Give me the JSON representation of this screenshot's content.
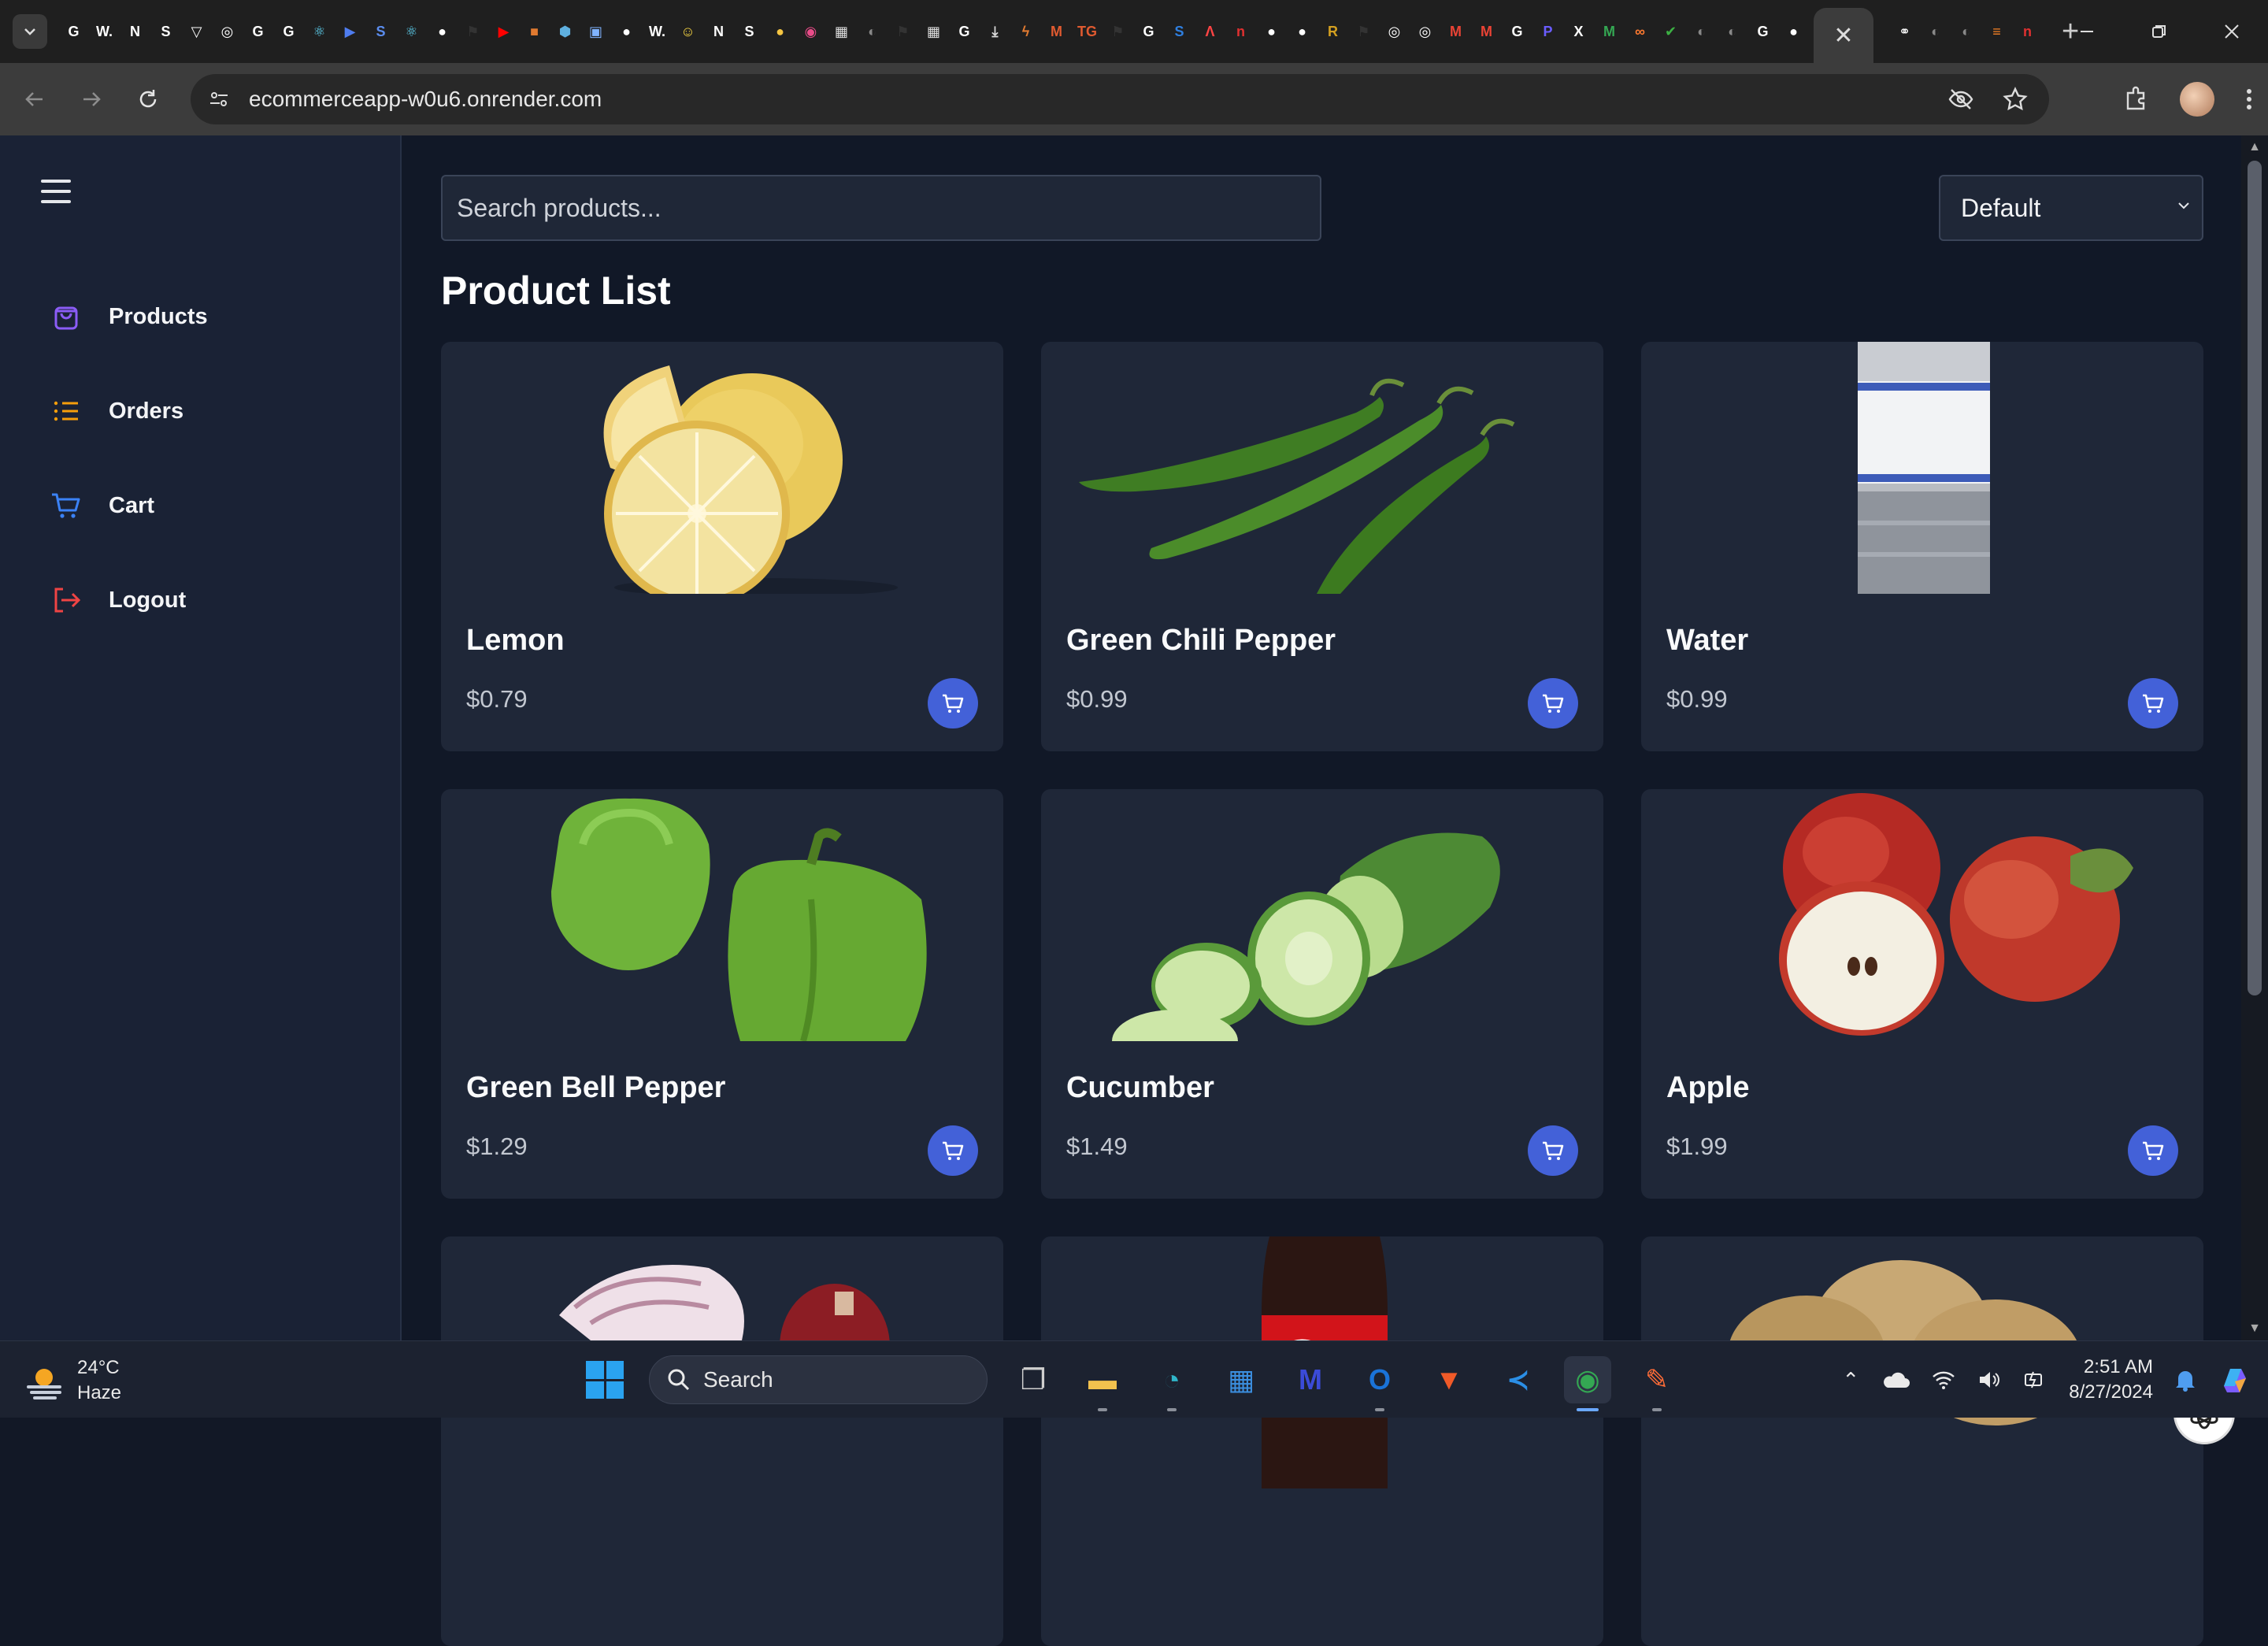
{
  "browser": {
    "url": "ecommerceapp-w0u6.onrender.com",
    "tab_close": "✕",
    "new_tab": "+",
    "tab_icons": [
      {
        "icon": "google-icon",
        "glyph": "G",
        "color": "#ffffff"
      },
      {
        "icon": "w-icon",
        "glyph": "W.",
        "color": "#ffffff"
      },
      {
        "icon": "notion-icon",
        "glyph": "N",
        "color": "#ffffff"
      },
      {
        "icon": "s-icon",
        "glyph": "S",
        "color": "#ffffff"
      },
      {
        "icon": "vercel-icon",
        "glyph": "▽",
        "color": "#ffffff"
      },
      {
        "icon": "openai-icon",
        "glyph": "◎",
        "color": "#ffffff"
      },
      {
        "icon": "google-icon",
        "glyph": "G",
        "color": "#ffffff"
      },
      {
        "icon": "google-icon",
        "glyph": "G",
        "color": "#ffffff"
      },
      {
        "icon": "react-icon",
        "glyph": "⚛",
        "color": "#61dafb"
      },
      {
        "icon": "play-icon",
        "glyph": "▶",
        "color": "#4f7df0"
      },
      {
        "icon": "s-icon",
        "glyph": "S",
        "color": "#5b8def"
      },
      {
        "icon": "react-icon",
        "glyph": "⚛",
        "color": "#61dafb"
      },
      {
        "icon": "github-icon",
        "glyph": "●",
        "color": "#ffffff"
      },
      {
        "icon": "flag-icon",
        "glyph": "⚑",
        "color": "#333333"
      },
      {
        "icon": "youtube-icon",
        "glyph": "▶",
        "color": "#ff0000"
      },
      {
        "icon": "box-icon",
        "glyph": "■",
        "color": "#e07a30"
      },
      {
        "icon": "cube-icon",
        "glyph": "⬢",
        "color": "#5fb0e0"
      },
      {
        "icon": "image-icon",
        "glyph": "▣",
        "color": "#7fb3ff"
      },
      {
        "icon": "github-icon",
        "glyph": "●",
        "color": "#ffffff"
      },
      {
        "icon": "w-icon",
        "glyph": "W.",
        "color": "#ffffff"
      },
      {
        "icon": "smiley-icon",
        "glyph": "☺",
        "color": "#f5d442"
      },
      {
        "icon": "notion-icon",
        "glyph": "N",
        "color": "#ffffff"
      },
      {
        "icon": "s-icon",
        "glyph": "S",
        "color": "#ffffff"
      },
      {
        "icon": "circle-icon",
        "glyph": "●",
        "color": "#f5c542"
      },
      {
        "icon": "dribbble-icon",
        "glyph": "◉",
        "color": "#ea4c89"
      },
      {
        "icon": "qr-icon",
        "glyph": "▦",
        "color": "#dddddd"
      },
      {
        "icon": "globe-icon",
        "glyph": "◐",
        "color": "#888888"
      },
      {
        "icon": "flag-icon",
        "glyph": "⚑",
        "color": "#333333"
      },
      {
        "icon": "qr-icon",
        "glyph": "▦",
        "color": "#dddddd"
      },
      {
        "icon": "google-icon",
        "glyph": "G",
        "color": "#ffffff"
      },
      {
        "icon": "download-icon",
        "glyph": "⤓",
        "color": "#dddddd"
      },
      {
        "icon": "bolt-icon",
        "glyph": "ϟ",
        "color": "#e07a30"
      },
      {
        "icon": "m-icon",
        "glyph": "M",
        "color": "#e05a30"
      },
      {
        "icon": "tg-icon",
        "glyph": "TG",
        "color": "#e05a30"
      },
      {
        "icon": "flag-icon",
        "glyph": "⚑",
        "color": "#333333"
      },
      {
        "icon": "google-icon",
        "glyph": "G",
        "color": "#ffffff"
      },
      {
        "icon": "s-icon",
        "glyph": "S",
        "color": "#2f7fe0"
      },
      {
        "icon": "a-icon",
        "glyph": "Λ",
        "color": "#ff4444"
      },
      {
        "icon": "n-icon",
        "glyph": "n",
        "color": "#e03030"
      },
      {
        "icon": "github-icon",
        "glyph": "●",
        "color": "#ffffff"
      },
      {
        "icon": "github-icon",
        "glyph": "●",
        "color": "#ffffff"
      },
      {
        "icon": "r-icon",
        "glyph": "R",
        "color": "#d4a020"
      },
      {
        "icon": "flag-icon",
        "glyph": "⚑",
        "color": "#333333"
      },
      {
        "icon": "openai-icon",
        "glyph": "◎",
        "color": "#ffffff"
      },
      {
        "icon": "openai-icon",
        "glyph": "◎",
        "color": "#ffffff"
      },
      {
        "icon": "gmail-icon",
        "glyph": "M",
        "color": "#ea4335"
      },
      {
        "icon": "gmail-icon",
        "glyph": "M",
        "color": "#ea4335"
      },
      {
        "icon": "google-icon",
        "glyph": "G",
        "color": "#ffffff"
      },
      {
        "icon": "p-icon",
        "glyph": "P",
        "color": "#6a5cff"
      },
      {
        "icon": "x-icon",
        "glyph": "X",
        "color": "#ffffff"
      },
      {
        "icon": "mail-icon",
        "glyph": "M",
        "color": "#34a853"
      },
      {
        "icon": "infinity-icon",
        "glyph": "∞",
        "color": "#ff7a30"
      },
      {
        "icon": "shield-icon",
        "glyph": "✔",
        "color": "#3cb043"
      },
      {
        "icon": "globe-icon",
        "glyph": "◐",
        "color": "#888888"
      },
      {
        "icon": "globe-icon",
        "glyph": "◐",
        "color": "#888888"
      },
      {
        "icon": "google-icon",
        "glyph": "G",
        "color": "#ffffff"
      },
      {
        "icon": "github-icon",
        "glyph": "●",
        "color": "#ffffff"
      }
    ],
    "tab_icons_after": [
      {
        "icon": "link-icon",
        "glyph": "⚭",
        "color": "#ffffff"
      },
      {
        "icon": "globe-icon",
        "glyph": "◐",
        "color": "#888888"
      },
      {
        "icon": "globe-icon",
        "glyph": "◐",
        "color": "#888888"
      },
      {
        "icon": "stack-icon",
        "glyph": "≡",
        "color": "#f48024"
      },
      {
        "icon": "n-icon",
        "glyph": "n",
        "color": "#e03030"
      }
    ]
  },
  "sidebar": {
    "items": [
      {
        "label": "Products",
        "icon": "bag-icon",
        "color": "#8b5cf6"
      },
      {
        "label": "Orders",
        "icon": "list-icon",
        "color": "#f59e0b"
      },
      {
        "label": "Cart",
        "icon": "cart-icon",
        "color": "#3b82f6"
      },
      {
        "label": "Logout",
        "icon": "logout-icon",
        "color": "#ef4444"
      }
    ]
  },
  "main": {
    "search_placeholder": "Search products...",
    "sort_selected": "Default",
    "title": "Product List"
  },
  "products": [
    {
      "name": "Lemon",
      "price": "$0.79",
      "image": "lemon"
    },
    {
      "name": "Green Chili Pepper",
      "price": "$0.99",
      "image": "chili"
    },
    {
      "name": "Water",
      "price": "$0.99",
      "image": "water"
    },
    {
      "name": "Green Bell Pepper",
      "price": "$1.29",
      "image": "bell-pepper"
    },
    {
      "name": "Cucumber",
      "price": "$1.49",
      "image": "cucumber"
    },
    {
      "name": "Apple",
      "price": "$1.99",
      "image": "apple"
    },
    {
      "name": "",
      "price": "",
      "image": "onion"
    },
    {
      "name": "",
      "price": "",
      "image": "cola"
    },
    {
      "name": "",
      "price": "",
      "image": "potato"
    }
  ],
  "taskbar": {
    "temperature": "24°C",
    "weather": "Haze",
    "search_label": "Search",
    "time": "2:51 AM",
    "date": "8/27/2024",
    "apps": [
      {
        "icon": "task-view-icon",
        "glyph": "❐",
        "color": "#cfcfcf"
      },
      {
        "icon": "file-explorer-icon",
        "glyph": "▬",
        "color": "#f2c14e"
      },
      {
        "icon": "edge-icon",
        "glyph": "◔",
        "color": "#2fb5c9"
      },
      {
        "icon": "store-icon",
        "glyph": "▦",
        "color": "#3b8fe0"
      },
      {
        "icon": "mathpix-icon",
        "glyph": "M",
        "color": "#3b4bd8"
      },
      {
        "icon": "outlook-icon",
        "glyph": "O",
        "color": "#1a73d8"
      },
      {
        "icon": "brave-icon",
        "glyph": "▼",
        "color": "#f05a28"
      },
      {
        "icon": "vscode-icon",
        "glyph": "≺",
        "color": "#2b8fe6"
      },
      {
        "icon": "chrome-icon",
        "glyph": "◉",
        "color": "#34a853"
      },
      {
        "icon": "postman-icon",
        "glyph": "✎",
        "color": "#ff6c37"
      }
    ]
  }
}
